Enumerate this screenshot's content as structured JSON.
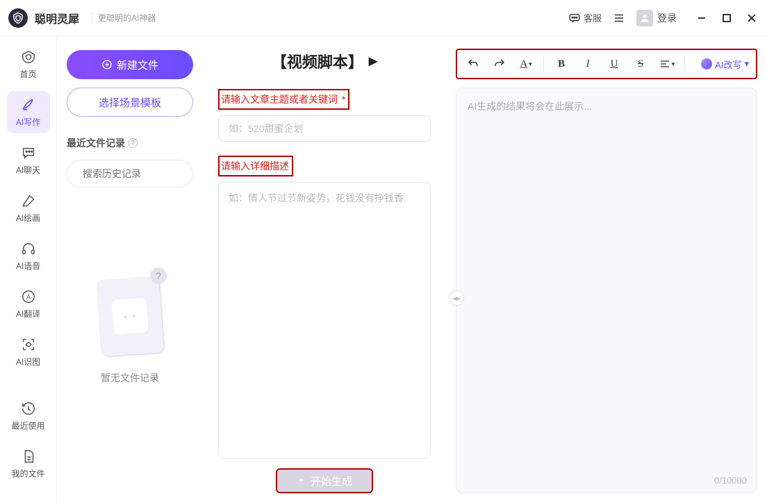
{
  "header": {
    "app_name": "聪明灵犀",
    "subtitle": "更聪明的AI神器",
    "support_label": "客服",
    "login_label": "登录"
  },
  "sidebar": {
    "items": [
      {
        "label": "首页"
      },
      {
        "label": "AI写作"
      },
      {
        "label": "AI聊天"
      },
      {
        "label": "AI绘画"
      },
      {
        "label": "AI语音"
      },
      {
        "label": "AI翻译"
      },
      {
        "label": "AI识图"
      }
    ],
    "bottom_items": [
      {
        "label": "最近使用"
      },
      {
        "label": "我的文件"
      }
    ]
  },
  "left": {
    "new_file_label": "新建文件",
    "template_label": "选择场景模板",
    "recent_label": "最近文件记录",
    "search_placeholder": "搜索历史记录",
    "empty_text": "暂无文件记录"
  },
  "mid": {
    "title": "【视频脚本】",
    "section1_label": "请输入文章主题或者关键词",
    "section1_required": "*",
    "topic_placeholder": "如：520甜蜜企划",
    "section2_label": "请输入详细描述",
    "desc_placeholder": "如：情人节过节新姿势，花钱没有挣钱香",
    "generate_label": "开始生成"
  },
  "right": {
    "rewrite_label": "AI改写",
    "result_placeholder": "AI生成的结果将会在此展示...",
    "counter": "0/10000"
  }
}
